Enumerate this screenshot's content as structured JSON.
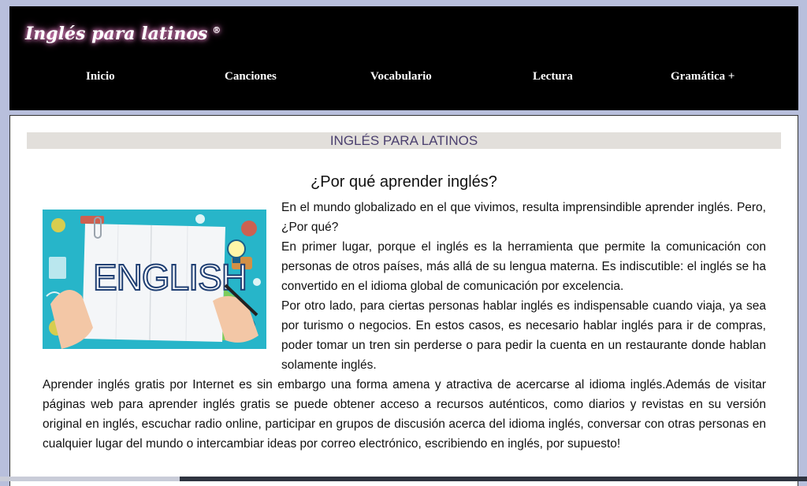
{
  "header": {
    "logo_text": "Inglés para latinos",
    "logo_mark": "®",
    "nav": [
      {
        "label": "Inicio"
      },
      {
        "label": "Canciones"
      },
      {
        "label": "Vocabulario"
      },
      {
        "label": "Lectura"
      },
      {
        "label": "Gramática +"
      }
    ]
  },
  "main": {
    "banner": "INGLÉS PARA LATINOS",
    "subtitle": "¿Por qué aprender inglés?",
    "image": {
      "word": "ENGLISH",
      "icon": "english-hero-image"
    },
    "paragraphs_right": [
      "En el mundo globalizado en el que vivimos, resulta imprensindible aprender inglés. Pero, ¿Por qué?",
      "En primer lugar, porque el inglés es la herramienta que permite la comunicación con personas de otros países, más allá de su lengua materna. Es indiscutible: el inglés se ha convertido en el idioma global de comunicación por excelencia.",
      "Por otro lado, para ciertas personas hablar inglés es indispensable cuando viaja, ya sea por turismo o negocios. En estos casos, es necesario hablar inglés para ir de compras, poder tomar un tren sin perderse o para pedir la cuenta en un restaurante donde hablan solamente inglés."
    ],
    "paragraph_full": "Aprender inglés gratis por Internet es sin embargo una forma amena y atractiva de acercarse al idioma inglés.Además de visitar páginas web para aprender inglés gratis se puede obtener acceso a recursos auténticos, como diarios y revistas en su versión original en inglés, escuchar radio online, participar en grupos de discusión acerca del idioma inglés, conversar con otras personas en cualquier lugar del mundo o intercambiar ideas por correo electrónico, escribiendo en inglés, por supuesto!"
  },
  "colors": {
    "header_bg": "#000000",
    "banner_bg": "#e2dfdb",
    "banner_text": "#4a3f6e",
    "page_bg": "#b8bfdc"
  }
}
